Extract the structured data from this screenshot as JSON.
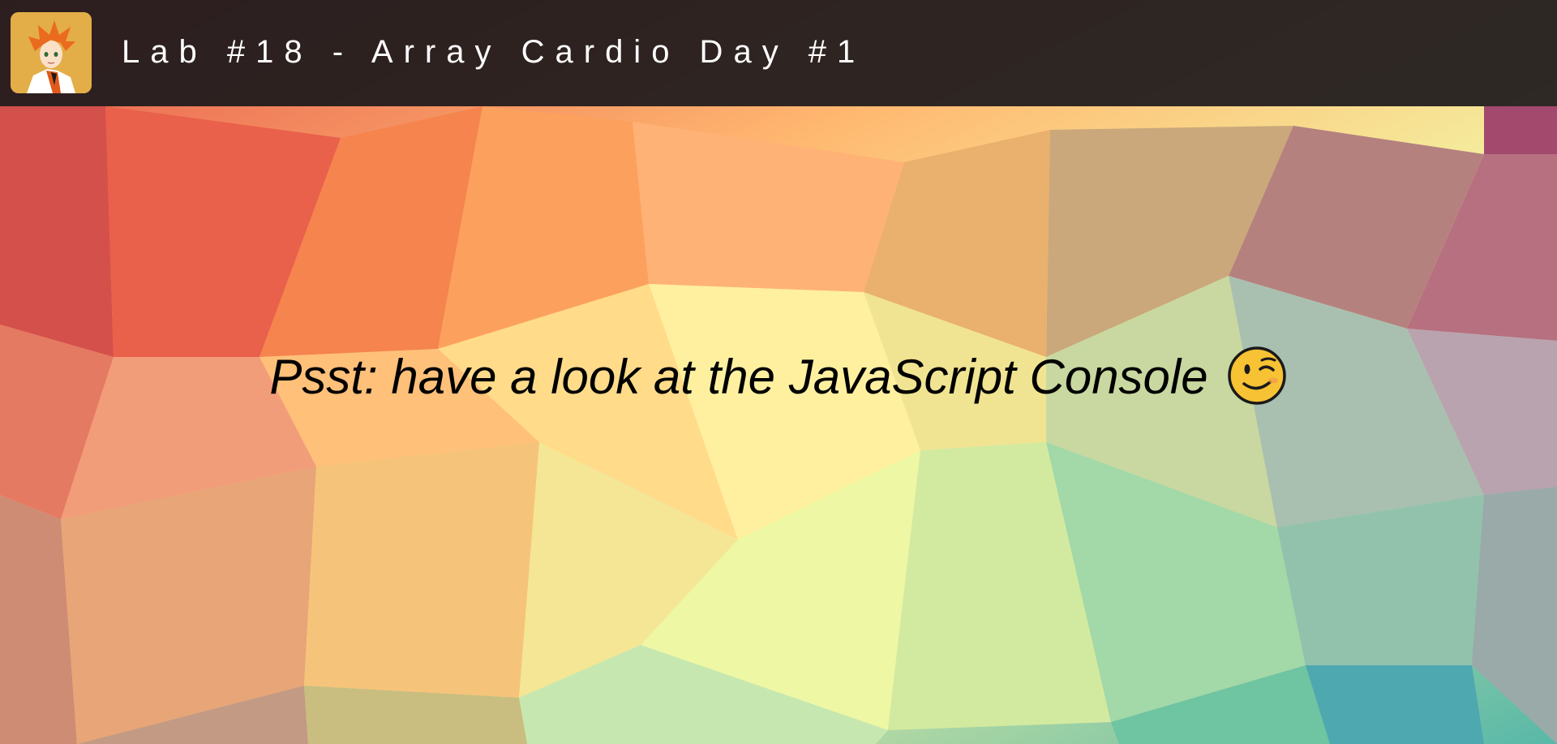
{
  "header": {
    "title": "Lab #18 - Array Cardio Day #1",
    "logo_icon": "anime-avatar-logo"
  },
  "main": {
    "message": "Psst: have a look at the JavaScript Console",
    "message_icon": "winking-face-emoji"
  },
  "colors": {
    "header_bg": "#1e1a1c",
    "title_text": "#ffffff",
    "message_text": "#000000",
    "logo_bg": "#e3ad48"
  }
}
